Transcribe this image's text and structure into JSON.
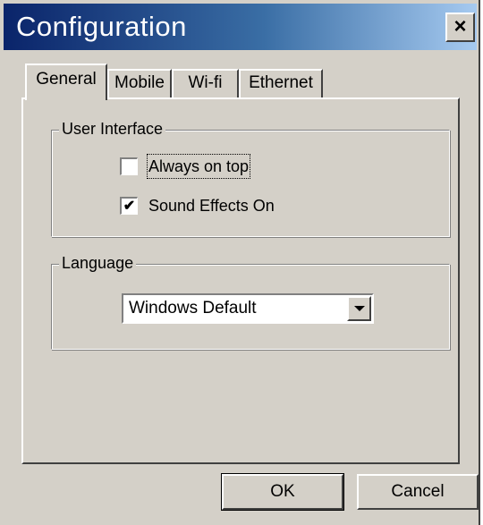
{
  "window": {
    "title": "Configuration",
    "close_symbol": "×"
  },
  "tabs": [
    {
      "label": "General",
      "active": true
    },
    {
      "label": "Mobile",
      "active": false
    },
    {
      "label": "Wi-fi",
      "active": false
    },
    {
      "label": "Ethernet",
      "active": false
    }
  ],
  "user_interface": {
    "label": "User Interface",
    "options": [
      {
        "label": "Always on top",
        "checked": false,
        "mark": ""
      },
      {
        "label": "Sound Effects On",
        "checked": true,
        "mark": "✔"
      }
    ]
  },
  "language": {
    "label": "Language",
    "selected": "Windows Default"
  },
  "buttons": {
    "ok": "OK",
    "cancel": "Cancel"
  },
  "colors": {
    "face": "#d4d0c8",
    "title_start": "#0a246a",
    "title_end": "#a6caf0"
  },
  "icons": {
    "close": "close-icon",
    "dropdown": "chevron-down-icon",
    "check": "checkmark-icon"
  }
}
